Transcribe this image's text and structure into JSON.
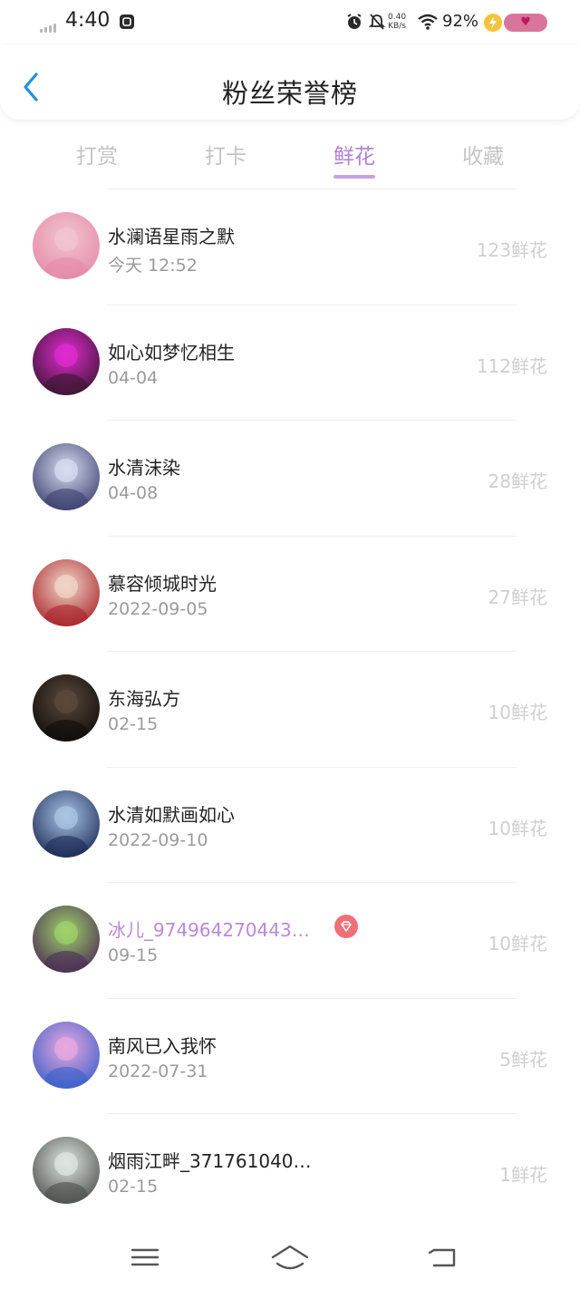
{
  "status_bar": {
    "time": "4:40",
    "net_speed_value": "0.40",
    "net_speed_unit": "KB/s",
    "battery_percent": "92%",
    "icons": [
      "signal-icon",
      "sim-icon",
      "alarm-icon",
      "mute-icon",
      "wifi-icon",
      "charging-icon",
      "battery-icon"
    ]
  },
  "header": {
    "title": "粉丝荣誉榜"
  },
  "tabs": [
    {
      "label": "打赏",
      "active": false
    },
    {
      "label": "打卡",
      "active": false
    },
    {
      "label": "鲜花",
      "active": true
    },
    {
      "label": "收藏",
      "active": false
    }
  ],
  "fans": [
    {
      "name": "水澜语星雨之默",
      "date": "今天 12:52",
      "count": "123鲜花",
      "vip": false,
      "avatar_colors": [
        "#f2c4d2",
        "#e48aa8"
      ]
    },
    {
      "name": "如心如梦忆相生",
      "date": "04-04",
      "count": "112鲜花",
      "vip": false,
      "avatar_colors": [
        "#e02bd0",
        "#3a1530"
      ]
    },
    {
      "name": "水清沫染",
      "date": "04-08",
      "count": "28鲜花",
      "vip": false,
      "avatar_colors": [
        "#d8dcf0",
        "#3b3f6e"
      ]
    },
    {
      "name": "慕容倾城时光",
      "date": "2022-09-05",
      "count": "27鲜花",
      "vip": false,
      "avatar_colors": [
        "#f0d6c8",
        "#a9232a"
      ]
    },
    {
      "name": "东海弘方",
      "date": "02-15",
      "count": "10鲜花",
      "vip": false,
      "avatar_colors": [
        "#5b4a3c",
        "#0e0b0a"
      ]
    },
    {
      "name": "水清如默画如心",
      "date": "2022-09-10",
      "count": "10鲜花",
      "vip": false,
      "avatar_colors": [
        "#a9c4e6",
        "#1b2a55"
      ]
    },
    {
      "name": "冰儿_974964270443…",
      "date": "09-15",
      "count": "10鲜花",
      "vip": true,
      "avatar_colors": [
        "#9fd16a",
        "#4a2a55"
      ]
    },
    {
      "name": "南风已入我怀",
      "date": "2022-07-31",
      "count": "5鲜花",
      "vip": false,
      "avatar_colors": [
        "#e8a8e0",
        "#3b5fc9"
      ]
    },
    {
      "name": "烟雨江畔_371761040…",
      "date": "02-15",
      "count": "1鲜花",
      "vip": false,
      "avatar_colors": [
        "#dfe6e0",
        "#4b4f4c"
      ]
    }
  ],
  "colors": {
    "accent": "#b07fd6",
    "tab_inactive": "#c4c4c4",
    "back_icon": "#1e90e6",
    "vip_name": "#b989d9",
    "vip_badge": "#f0707a"
  },
  "bottom_nav": [
    "menu-icon",
    "home-icon",
    "back-nav-icon"
  ]
}
